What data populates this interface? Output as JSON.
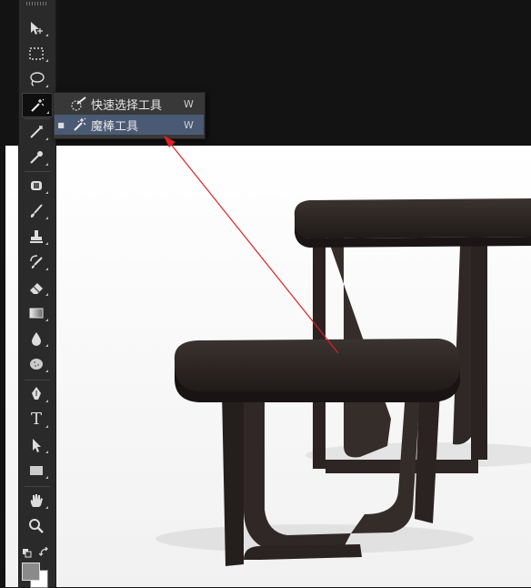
{
  "toolbar": {
    "tools": [
      {
        "name": "move-tool",
        "icon": "move-icon"
      },
      {
        "name": "marquee-tool",
        "icon": "rect-marquee-icon"
      },
      {
        "name": "lasso-tool",
        "icon": "lasso-icon"
      },
      {
        "name": "magic-wand-tool",
        "icon": "magic-wand-icon",
        "active": true
      },
      {
        "name": "crop-tool",
        "icon": "crop-icon"
      },
      {
        "name": "eyedropper-tool",
        "icon": "eyedropper-icon"
      },
      {
        "name": "healing-tool",
        "icon": "bandage-icon"
      },
      {
        "name": "brush-tool",
        "icon": "brush-icon"
      },
      {
        "name": "stamp-tool",
        "icon": "stamp-icon"
      },
      {
        "name": "history-brush-tool",
        "icon": "history-brush-icon"
      },
      {
        "name": "eraser-tool",
        "icon": "eraser-icon"
      },
      {
        "name": "gradient-tool",
        "icon": "gradient-icon"
      },
      {
        "name": "blur-tool",
        "icon": "drop-icon"
      },
      {
        "name": "dodge-tool",
        "icon": "sponge-icon"
      },
      {
        "name": "pen-tool",
        "icon": "pen-icon"
      },
      {
        "name": "type-tool",
        "icon": "type-icon",
        "glyph": "T"
      },
      {
        "name": "path-select-tool",
        "icon": "arrow-icon"
      },
      {
        "name": "shape-tool",
        "icon": "rectangle-icon"
      },
      {
        "name": "hand-tool",
        "icon": "hand-icon"
      },
      {
        "name": "zoom-tool",
        "icon": "zoom-icon"
      }
    ],
    "colors": {
      "foreground": "#8a8a8a",
      "background": "#ffffff"
    }
  },
  "flyout": {
    "items": [
      {
        "label": "快速选择工具",
        "shortcut": "W",
        "icon": "quick-selection-icon",
        "selected": false
      },
      {
        "label": "魔棒工具",
        "shortcut": "W",
        "icon": "magic-wand-icon",
        "selected": true
      }
    ]
  },
  "annotation": {
    "color": "#e02020"
  },
  "canvas": {
    "background": "#ffffff",
    "subject": "two dark wooden side tables"
  }
}
